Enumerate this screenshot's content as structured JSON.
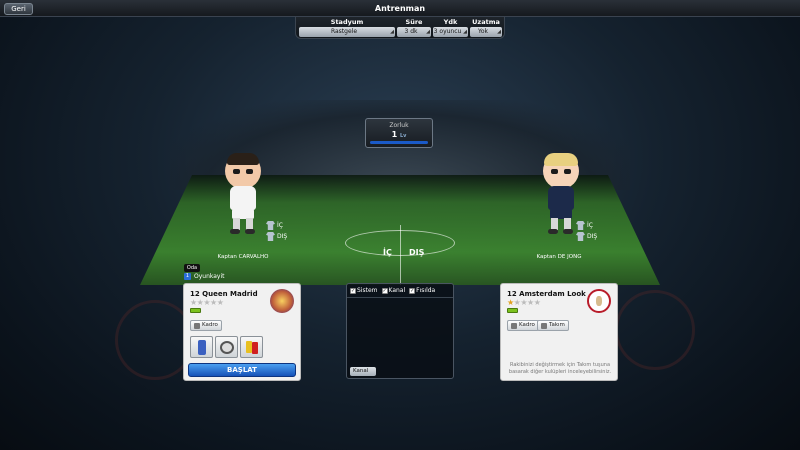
{
  "header": {
    "back_label": "Geri",
    "title": "Antrenman"
  },
  "settings": [
    {
      "label": "Stadyum",
      "value": "Rastgele"
    },
    {
      "label": "Süre",
      "value": "3 dk"
    },
    {
      "label": "Ydk",
      "value": "3 oyuncu"
    },
    {
      "label": "Uzatma",
      "value": "Yok"
    }
  ],
  "difficulty": {
    "label": "Zorluk",
    "value": "1",
    "unit": "Lv"
  },
  "players": {
    "left": {
      "captain": "Kaptan CARVALHO",
      "home": "İÇ",
      "away": "DIŞ"
    },
    "right": {
      "captain": "Kaptan DE JONG",
      "home": "İÇ",
      "away": "DIŞ"
    }
  },
  "field_labels": {
    "home": "İÇ",
    "away": "DIŞ"
  },
  "room": {
    "tag": "Oda",
    "owner": "Oyunkayit",
    "owner_icon_text": "1"
  },
  "left_team": {
    "name": "12 Queen Madrid",
    "stars": 0,
    "squad_label": "Kadro",
    "start_label": "BAŞLAT"
  },
  "right_team": {
    "name": "12 Amsterdam Look",
    "stars": 1,
    "squad_label": "Kadro",
    "team_label": "Takım",
    "hint": "Rakibinizi değiştirmek için Takım tuşuna basarak diğer kulüpleri inceleyebilirsiniz."
  },
  "chat": {
    "filters": [
      "Sistem",
      "Kanal",
      "Fısıldа"
    ],
    "channel_label": "Kanal"
  }
}
